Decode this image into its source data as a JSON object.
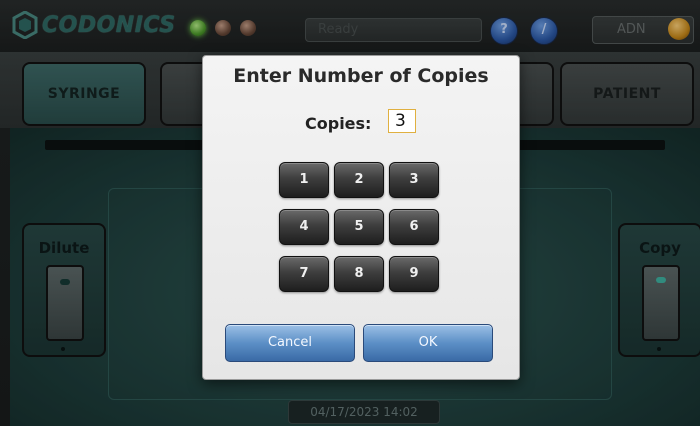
{
  "header": {
    "logo_text": "CODONICS",
    "status": "Ready",
    "user": "ADN",
    "help_icon": "question-icon",
    "tools_icon": "wrench-icon"
  },
  "tabs": [
    {
      "label": "SYRINGE"
    },
    {
      "label": ""
    },
    {
      "label": ""
    },
    {
      "label": "PATIENT"
    }
  ],
  "side_panels": {
    "left_label": "Dilute",
    "right_label": "Copy"
  },
  "datetime": "04/17/2023 14:02",
  "dialog": {
    "title": "Enter Number of Copies",
    "copies_label": "Copies:",
    "copies_value": "3",
    "keys": [
      "1",
      "2",
      "3",
      "4",
      "5",
      "6",
      "7",
      "8",
      "9"
    ],
    "cancel_label": "Cancel",
    "ok_label": "OK"
  },
  "colors": {
    "accent_blue": "#5c8fc6",
    "teal_background": "#2f5854",
    "status_led_green": "#4e9c2c"
  }
}
